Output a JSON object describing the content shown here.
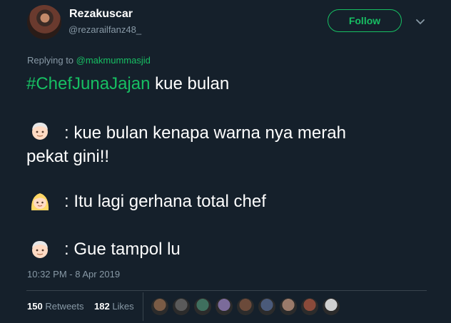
{
  "user": {
    "name": "Rezakuscar",
    "handle": "@rezarailfanz48_"
  },
  "follow_label": "Follow",
  "reply": {
    "prefix": "Replying to ",
    "to": "@makmummasjid"
  },
  "tweet": {
    "hashtag": "#ChefJunaJajan",
    "line1_rest": " kue bulan",
    "line2": ": kue bulan kenapa warna nya merah",
    "line3": "pekat gini!!",
    "line4": ": Itu lagi gerhana total chef",
    "line5": ": Gue tampol lu"
  },
  "timestamp": "10:32 PM - 8 Apr 2019",
  "stats": {
    "retweets_count": "150",
    "retweets_label": "Retweets",
    "likes_count": "182",
    "likes_label": "Likes"
  },
  "colors": {
    "background": "#15202b",
    "accent": "#17bf63",
    "muted": "#8899a6"
  },
  "icons": [
    "chevron-down-icon",
    "man-emoji-icon",
    "blond-woman-emoji-icon"
  ],
  "liker_colors": [
    "#7a5b45",
    "#5a5a5a",
    "#3f6f5e",
    "#7b6b9a",
    "#6b4a3a",
    "#4a5a7a",
    "#9a7a6a",
    "#8a4a3a",
    "#d0d0d0"
  ]
}
